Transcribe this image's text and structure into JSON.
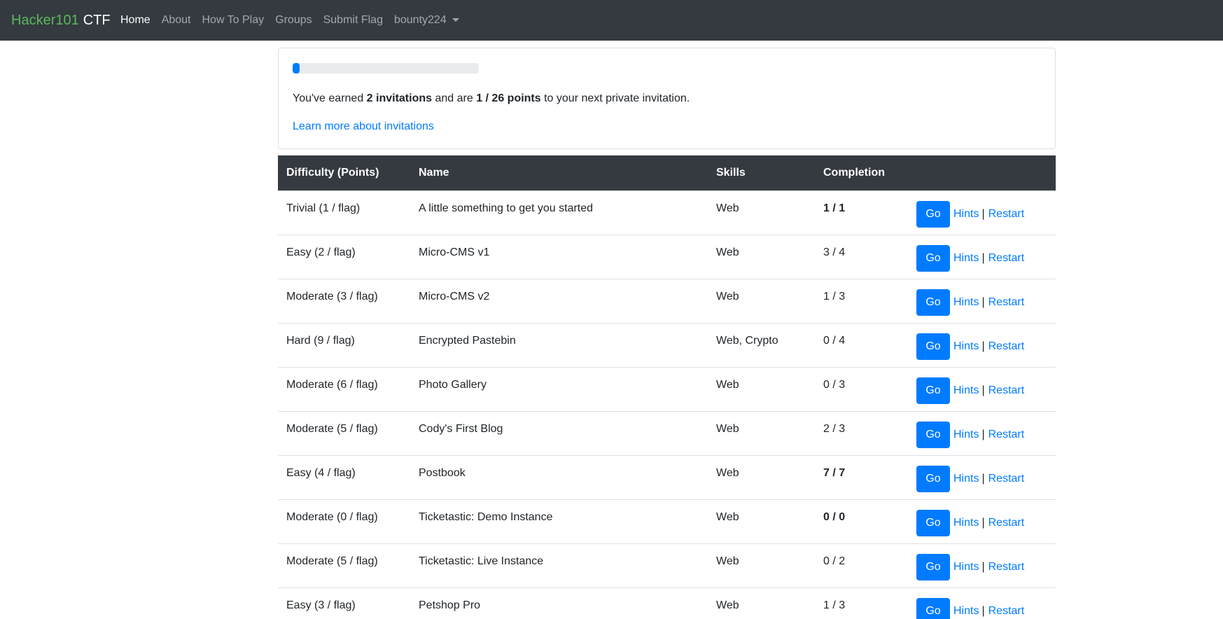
{
  "navbar": {
    "brand_primary": "Hacker101",
    "brand_secondary": "CTF",
    "items": [
      {
        "label": "Home",
        "active": true
      },
      {
        "label": "About",
        "active": false
      },
      {
        "label": "How To Play",
        "active": false
      },
      {
        "label": "Groups",
        "active": false
      },
      {
        "label": "Submit Flag",
        "active": false
      }
    ],
    "user": "bounty224"
  },
  "invitation": {
    "progress_fraction": 0.038,
    "text_prefix": "You've earned ",
    "invitations": "2 invitations",
    "text_middle": " and are ",
    "points": "1 / 26 points",
    "text_suffix": " to your next private invitation.",
    "link": "Learn more about invitations"
  },
  "table": {
    "headers": {
      "difficulty": "Difficulty (Points)",
      "name": "Name",
      "skills": "Skills",
      "completion": "Completion"
    },
    "action_labels": {
      "go": "Go",
      "hints": "Hints",
      "separator": "|",
      "restart": "Restart"
    },
    "rows": [
      {
        "difficulty": "Trivial (1 / flag)",
        "name": "A little something to get you started",
        "skills": "Web",
        "completion": "1 / 1",
        "bold": true
      },
      {
        "difficulty": "Easy (2 / flag)",
        "name": "Micro-CMS v1",
        "skills": "Web",
        "completion": "3 / 4",
        "bold": false
      },
      {
        "difficulty": "Moderate (3 / flag)",
        "name": "Micro-CMS v2",
        "skills": "Web",
        "completion": "1 / 3",
        "bold": false
      },
      {
        "difficulty": "Hard (9 / flag)",
        "name": "Encrypted Pastebin",
        "skills": "Web, Crypto",
        "completion": "0 / 4",
        "bold": false
      },
      {
        "difficulty": "Moderate (6 / flag)",
        "name": "Photo Gallery",
        "skills": "Web",
        "completion": "0 / 3",
        "bold": false
      },
      {
        "difficulty": "Moderate (5 / flag)",
        "name": "Cody's First Blog",
        "skills": "Web",
        "completion": "2 / 3",
        "bold": false
      },
      {
        "difficulty": "Easy (4 / flag)",
        "name": "Postbook",
        "skills": "Web",
        "completion": "7 / 7",
        "bold": true
      },
      {
        "difficulty": "Moderate (0 / flag)",
        "name": "Ticketastic: Demo Instance",
        "skills": "Web",
        "completion": "0 / 0",
        "bold": true
      },
      {
        "difficulty": "Moderate (5 / flag)",
        "name": "Ticketastic: Live Instance",
        "skills": "Web",
        "completion": "0 / 2",
        "bold": false
      },
      {
        "difficulty": "Easy (3 / flag)",
        "name": "Petshop Pro",
        "skills": "Web",
        "completion": "1 / 3",
        "bold": false
      }
    ]
  },
  "colors": {
    "navbar_bg": "#343a40",
    "brand_green": "#5cb85c",
    "primary": "#007bff"
  }
}
